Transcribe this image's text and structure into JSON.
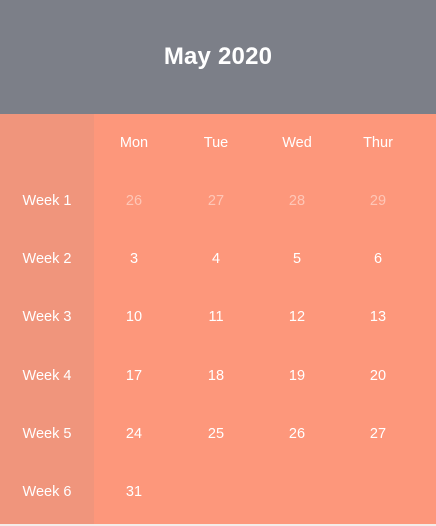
{
  "title": "May 2020",
  "days": [
    "Mon",
    "Tue",
    "Wed",
    "Thur"
  ],
  "weeks": [
    {
      "label": "Week 1",
      "dates": [
        "26",
        "27",
        "28",
        "29"
      ],
      "muted": [
        true,
        true,
        true,
        true
      ]
    },
    {
      "label": "Week 2",
      "dates": [
        "3",
        "4",
        "5",
        "6"
      ],
      "muted": [
        false,
        false,
        false,
        false
      ]
    },
    {
      "label": "Week 3",
      "dates": [
        "10",
        "11",
        "12",
        "13"
      ],
      "muted": [
        false,
        false,
        false,
        false
      ]
    },
    {
      "label": "Week 4",
      "dates": [
        "17",
        "18",
        "19",
        "20"
      ],
      "muted": [
        false,
        false,
        false,
        false
      ]
    },
    {
      "label": "Week 5",
      "dates": [
        "24",
        "25",
        "26",
        "27"
      ],
      "muted": [
        false,
        false,
        false,
        false
      ]
    },
    {
      "label": "Week 6",
      "dates": [
        "31",
        "",
        "",
        ""
      ],
      "muted": [
        false,
        false,
        false,
        false
      ]
    }
  ],
  "colors": {
    "header": "#7c7f88",
    "body": "#fd977b",
    "week_column": "#f0957c",
    "text": "#ffffff"
  }
}
